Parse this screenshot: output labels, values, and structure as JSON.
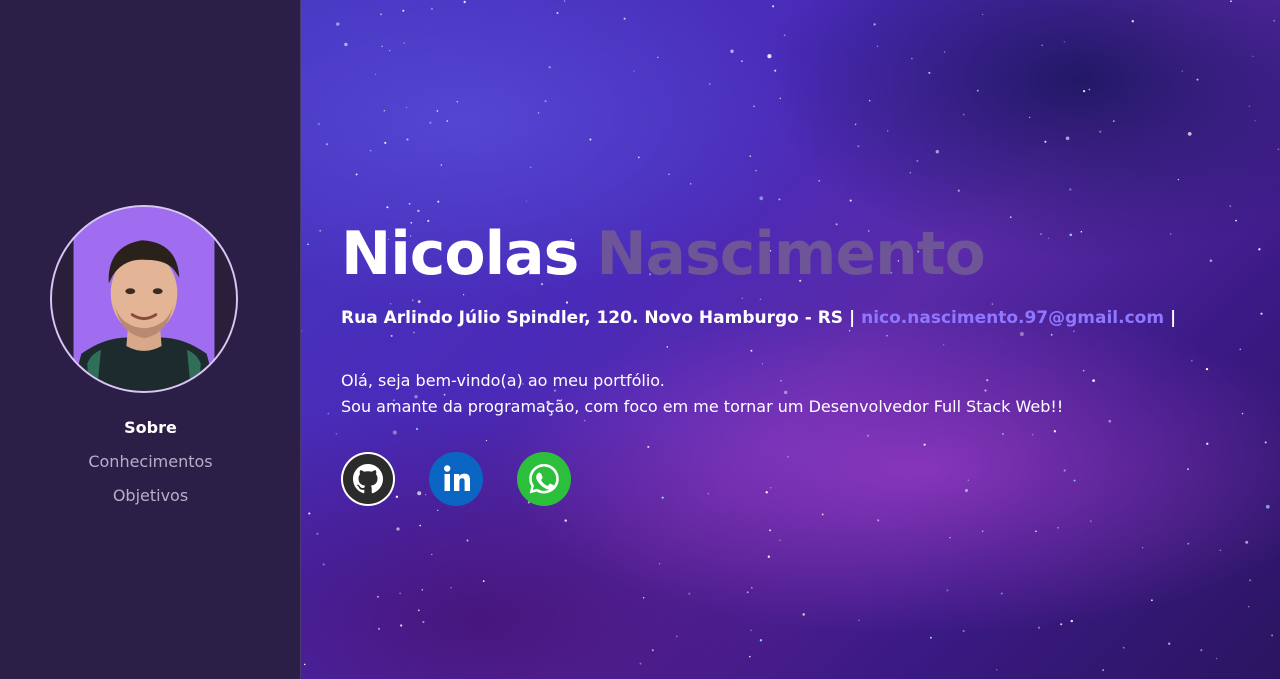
{
  "sidebar": {
    "nav": [
      {
        "label": "Sobre",
        "active": true
      },
      {
        "label": "Conhecimentos",
        "active": false
      },
      {
        "label": "Objetivos",
        "active": false
      }
    ]
  },
  "hero": {
    "first_name": "Nicolas",
    "last_name": "Nascimento",
    "address": "Rua Arlindo Júlio Spindler, 120. Novo Hamburgo - RS |",
    "email": "nico.nascimento.97@gmail.com",
    "separator": "|",
    "intro_line1": "Olá, seja bem-vindo(a) ao meu portfólio.",
    "intro_line2": "Sou amante da programação, com foco em me tornar um Desenvolvedor Full Stack Web!!"
  },
  "socials": [
    {
      "icon": "github-icon",
      "color": "#333333"
    },
    {
      "icon": "linkedin-icon",
      "color": "#0a66c2"
    },
    {
      "icon": "whatsapp-icon",
      "color": "#25d366"
    }
  ],
  "colors": {
    "sidebar_bg": "#2b1f47",
    "accent": "#8f78ff",
    "last_name": "#6d5597"
  }
}
